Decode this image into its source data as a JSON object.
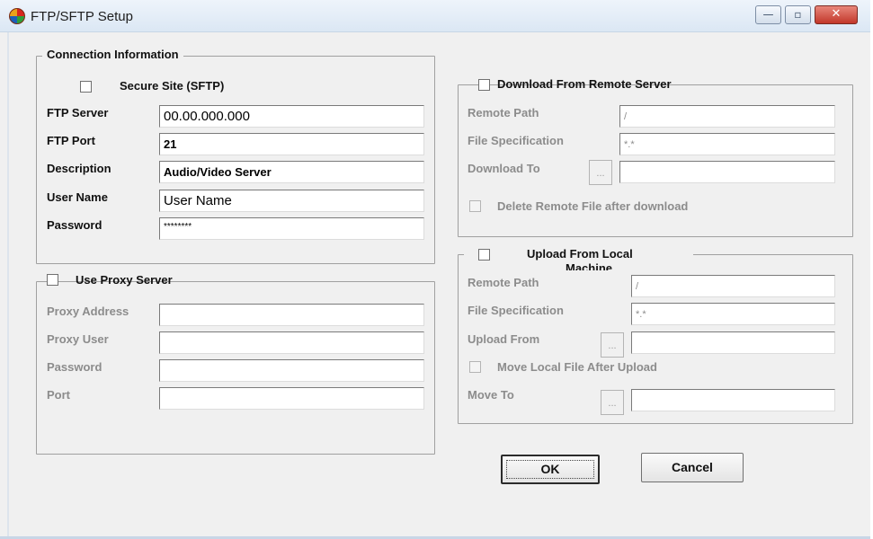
{
  "window": {
    "title": "FTP/SFTP  Setup",
    "minimize_glyph": "—",
    "maximize_glyph": "▫",
    "close_glyph": "✕"
  },
  "connection": {
    "legend": "Connection Information",
    "secure_label": "Secure Site (SFTP)",
    "server_label": "FTP Server",
    "server_value": "00.00.000.000",
    "port_label": "FTP Port",
    "port_value": "21",
    "description_label": "Description",
    "description_value": "Audio/Video Server",
    "username_label": "User Name",
    "username_value": "User Name",
    "password_label": "Password",
    "password_value": "********"
  },
  "proxy": {
    "legend": "Use Proxy Server",
    "address_label": "Proxy Address",
    "user_label": "Proxy User",
    "password_label": "Password",
    "port_label": "Port"
  },
  "download": {
    "legend": "Download From Remote Server",
    "remote_path_label": "Remote Path",
    "remote_path_value": "/",
    "file_spec_label": "File Specification",
    "file_spec_value": "*.*",
    "download_to_label": "Download To",
    "browse_glyph": "...",
    "delete_label": "Delete Remote File after download"
  },
  "upload": {
    "legend": "Upload From Local",
    "legend_overflow": "Machine",
    "remote_path_label": "Remote Path",
    "remote_path_value": "/",
    "file_spec_label": "File Specification",
    "file_spec_value": "*.*",
    "upload_from_label": "Upload From",
    "browse_glyph": "...",
    "move_label": "Move Local File After Upload",
    "move_to_label": "Move To"
  },
  "buttons": {
    "ok": "OK",
    "cancel": "Cancel"
  },
  "icons": {
    "app": "globe-icon"
  }
}
